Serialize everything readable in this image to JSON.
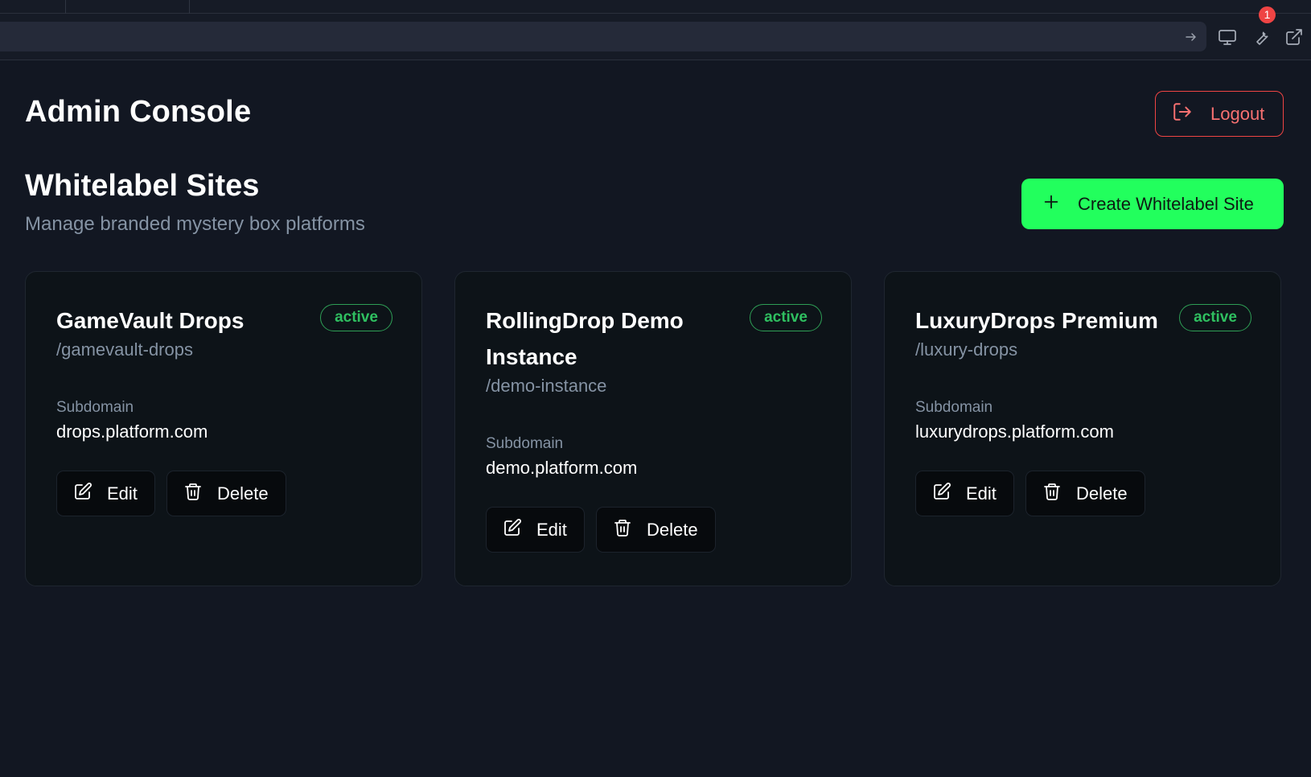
{
  "browser": {
    "notifications": "1",
    "icons": [
      "arrow-right-icon",
      "monitor-icon",
      "wrench-icon",
      "external-link-icon"
    ]
  },
  "header": {
    "title": "Admin Console",
    "logout_label": "Logout"
  },
  "section": {
    "title": "Whitelabel Sites",
    "subtitle": "Manage branded mystery box platforms",
    "create_label": "Create Whitelabel Site"
  },
  "sites": [
    {
      "name": "GameVault Drops",
      "status": "active",
      "slug": "/gamevault-drops",
      "subdomain_label": "Subdomain",
      "subdomain": "drops.platform.com",
      "edit_label": "Edit",
      "delete_label": "Delete"
    },
    {
      "name": "RollingDrop Demo Instance",
      "status": "active",
      "slug": "/demo-instance",
      "subdomain_label": "Subdomain",
      "subdomain": "demo.platform.com",
      "edit_label": "Edit",
      "delete_label": "Delete"
    },
    {
      "name": "LuxuryDrops Premium",
      "status": "active",
      "slug": "/luxury-drops",
      "subdomain_label": "Subdomain",
      "subdomain": "luxurydrops.platform.com",
      "edit_label": "Edit",
      "delete_label": "Delete"
    }
  ],
  "colors": {
    "background": "#121722",
    "card": "#0d1318",
    "accent_green": "#22ff5d",
    "status_green": "#2fbf60",
    "danger": "#ef4444",
    "muted_text": "#8593a4"
  }
}
